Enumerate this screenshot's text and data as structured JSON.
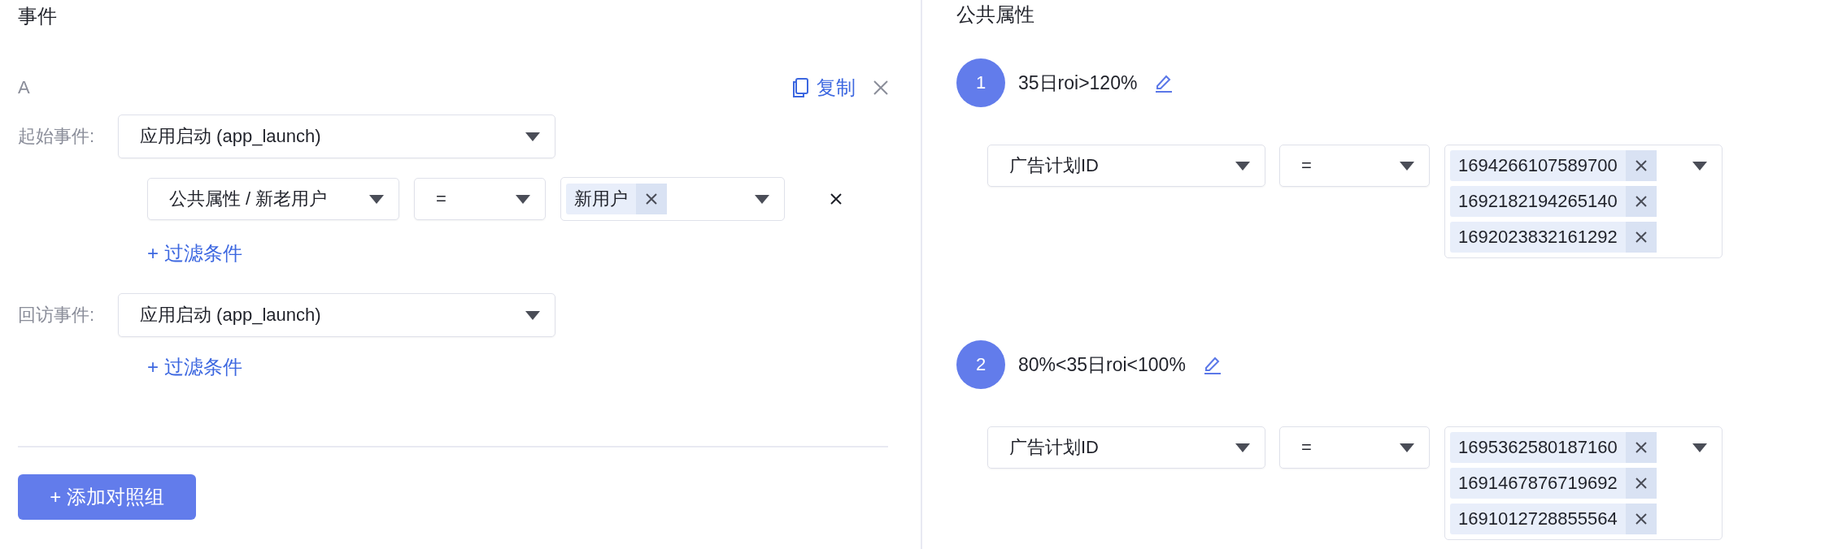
{
  "left": {
    "title": "事件",
    "group": {
      "label": "A",
      "copy": "复制",
      "start": {
        "label": "起始事件:",
        "event": "应用启动 (app_launch)",
        "filters": [
          {
            "property": "公共属性 / 新老用户",
            "operator": "=",
            "values": [
              "新用户"
            ]
          }
        ],
        "add_filter": "+ 过滤条件"
      },
      "revisit": {
        "label": "回访事件:",
        "event": "应用启动 (app_launch)",
        "add_filter": "+ 过滤条件"
      }
    },
    "add_group": "+ 添加对照组"
  },
  "right": {
    "title": "公共属性",
    "groups": [
      {
        "index": "1",
        "name": "35日roi>120%",
        "filters": [
          {
            "property": "广告计划ID",
            "operator": "=",
            "values": [
              "1694266107589700",
              "1692182194265140",
              "1692023832161292"
            ]
          }
        ]
      },
      {
        "index": "2",
        "name": "80%<35日roi<100%",
        "filters": [
          {
            "property": "广告计划ID",
            "operator": "=",
            "values": [
              "1695362580187160",
              "1691467876719692",
              "1691012728855564"
            ]
          }
        ]
      }
    ]
  }
}
